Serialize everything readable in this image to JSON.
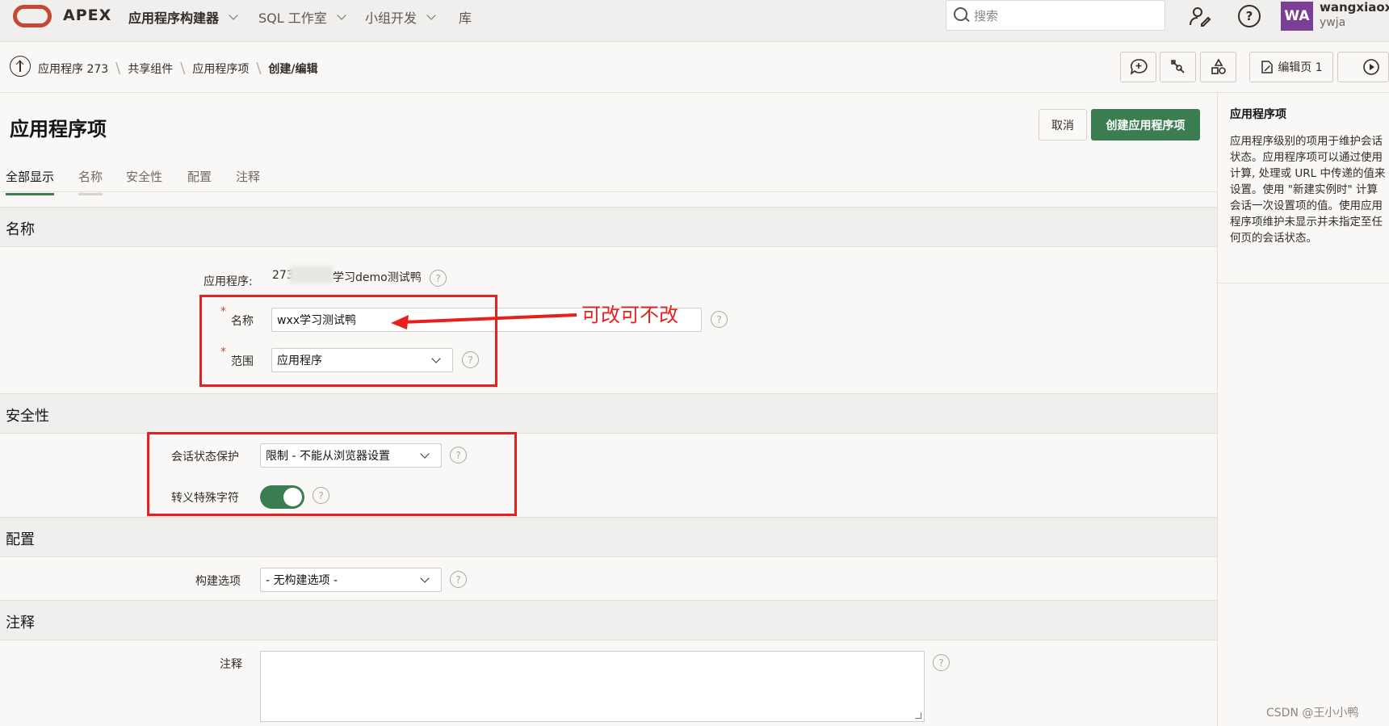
{
  "brand": {
    "name": "APEX"
  },
  "topnav": [
    {
      "label": "应用程序构建器"
    },
    {
      "label": "SQL 工作室"
    },
    {
      "label": "小组开发"
    },
    {
      "label": "库"
    }
  ],
  "search": {
    "placeholder": "搜索"
  },
  "user": {
    "initials": "WA",
    "name": "wangxiaoxi",
    "sub": "ywja"
  },
  "breadcrumb": [
    "应用程序 273",
    "共享组件",
    "应用程序项",
    "创建/编辑"
  ],
  "toolbar": {
    "edit_page_label": "编辑页 1"
  },
  "page": {
    "title": "应用程序项",
    "cancel_label": "取消",
    "create_label": "创建应用程序项"
  },
  "tabs": [
    "全部显示",
    "名称",
    "安全性",
    "配置",
    "注释"
  ],
  "sections": {
    "name": {
      "title": "名称",
      "app_label": "应用程序:",
      "app_value_prefix": "273",
      "app_value_suffix": "学习demo测试鸭",
      "name_label": "名称",
      "name_value": "wxx学习测试鸭",
      "scope_label": "范围",
      "scope_value": "应用程序"
    },
    "security": {
      "title": "安全性",
      "protection_label": "会话状态保护",
      "protection_value": "限制 - 不能从浏览器设置",
      "escape_label": "转义特殊字符",
      "escape_on": true
    },
    "config": {
      "title": "配置",
      "build_label": "构建选项",
      "build_value": "- 无构建选项 -"
    },
    "comments": {
      "title": "注释",
      "comments_label": "注释",
      "comments_value": ""
    }
  },
  "annotation": {
    "text": "可改可不改"
  },
  "help_panel": {
    "title": "应用程序项",
    "body": "应用程序级别的项用于维护会话\n状态。应用程序项可以通过使用\n计算, 处理或 URL 中传递的值来\n设置。使用 \"新建实例时\" 计算\n会话一次设置项的值。使用应用\n程序项维护未显示并未指定至任\n何页的会话状态。"
  },
  "watermark": "CSDN @王小小鸭",
  "colors": {
    "primary": "#3a7d51",
    "annotation": "#e7201e",
    "avatar": "#7b3e96",
    "logo": "#c74634"
  }
}
